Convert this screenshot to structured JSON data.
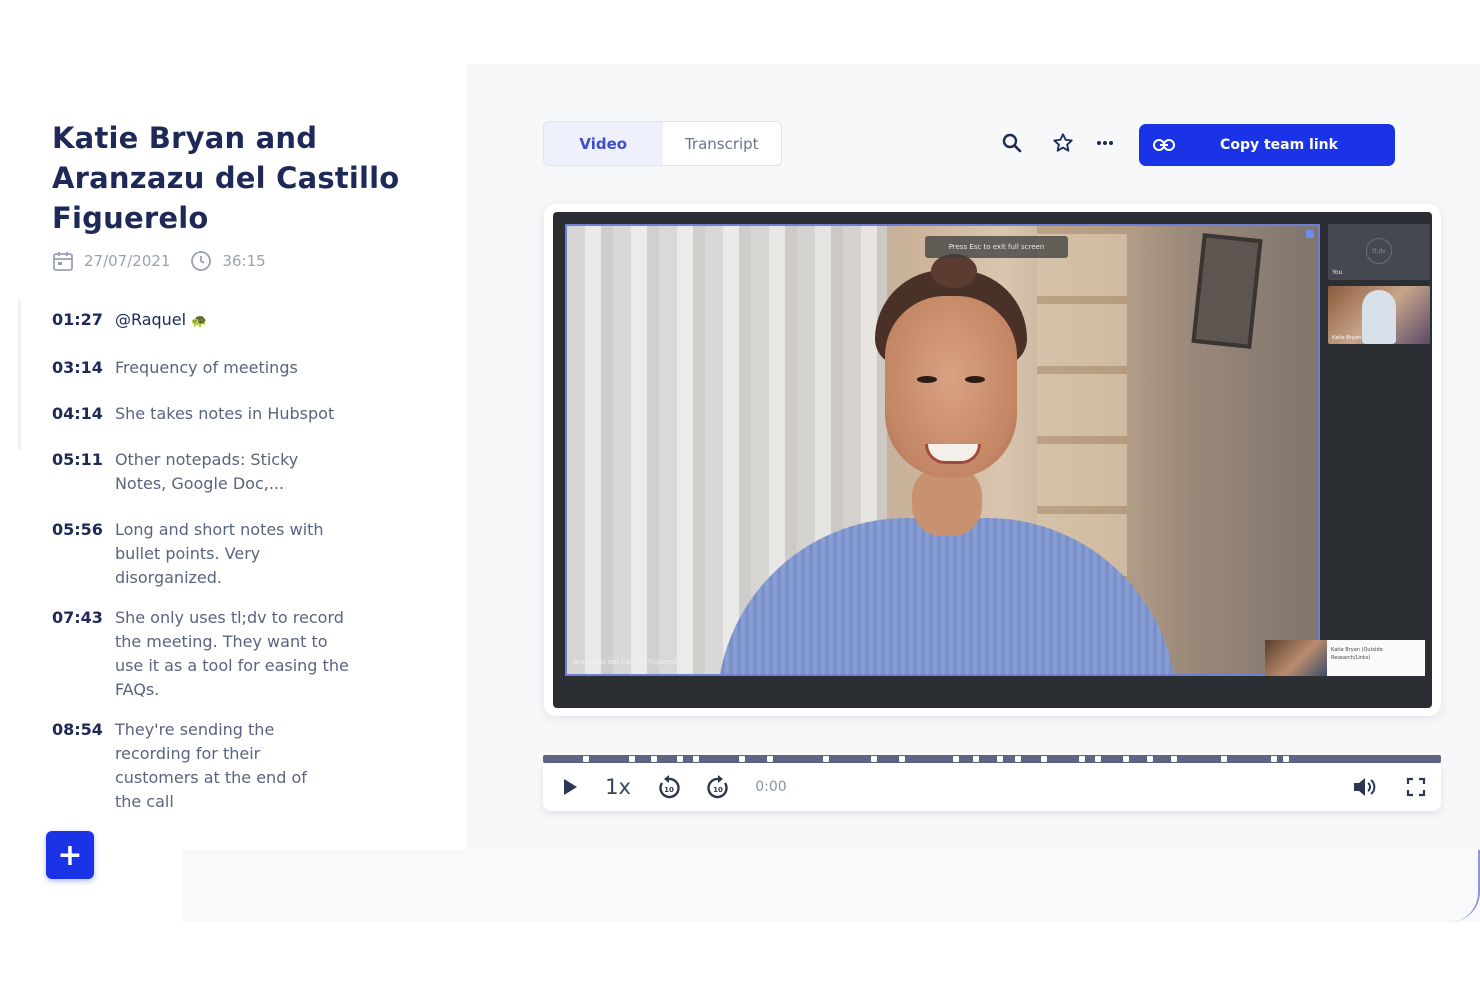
{
  "meeting": {
    "title": "Katie Bryan and Aranzazu del Castillo Figuerelo",
    "date": "27/07/2021",
    "duration": "36:15"
  },
  "notes": [
    {
      "time": "01:27",
      "text": "@Raquel",
      "emoji": "turtle-icon"
    },
    {
      "time": "03:14",
      "text": "Frequency of meetings"
    },
    {
      "time": "04:14",
      "text": "She takes notes in Hubspot"
    },
    {
      "time": "05:11",
      "text": "Other notepads: Sticky Notes, Google Doc,..."
    },
    {
      "time": "05:56",
      "text": "Long and short notes with bullet points. Very disorganized."
    },
    {
      "time": "07:43",
      "text": "She only uses tl;dv to record the meeting. They want to use it as a tool for easing the FAQs."
    },
    {
      "time": "08:54",
      "text": "They're sending the recording for their customers at the end of the call"
    }
  ],
  "add_button": {
    "label": "+"
  },
  "tabs": [
    {
      "label": "Video",
      "active": true
    },
    {
      "label": "Transcript",
      "active": false
    }
  ],
  "toolbar": {
    "icons": [
      "search-icon",
      "star-icon",
      "more-icon"
    ],
    "copy_label": "Copy team link",
    "copy_icon": "link-icon"
  },
  "video": {
    "esc_hint": "Press Esc to exit full screen",
    "main_participant": "Aranzazu del Castillo Figuerelo",
    "self_label": "You",
    "self_initials": "tl;dv",
    "tile_label": "Katie Bryan",
    "mini_label": "Katie Bryan (Outside Research/Links)"
  },
  "player": {
    "speed": "1x",
    "time": "0:00",
    "progress": 0
  },
  "colors": {
    "accent": "#1a33e6",
    "title": "#1e2957",
    "muted": "#9aa0b4"
  }
}
